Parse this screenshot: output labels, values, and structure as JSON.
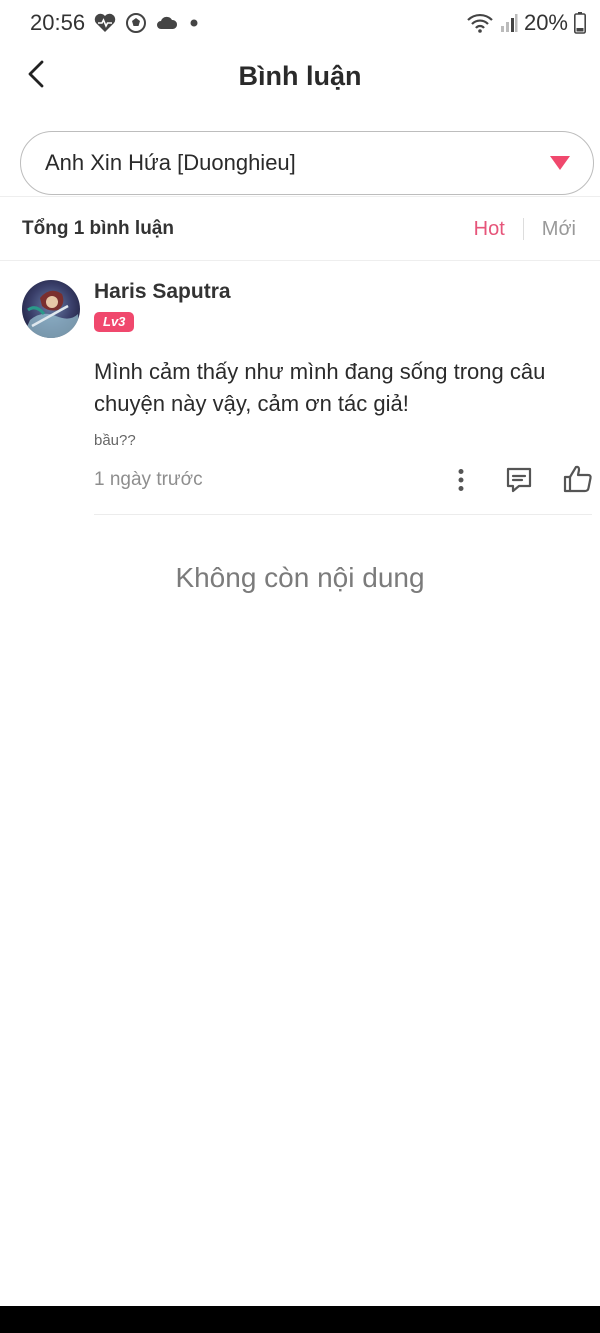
{
  "status_bar": {
    "time": "20:56",
    "battery": "20%",
    "icons": [
      "heart-rate-icon",
      "soccer-ball-icon",
      "cloud-icon",
      "dot-icon",
      "wifi-icon",
      "signal-icon",
      "battery-icon"
    ]
  },
  "header": {
    "title": "Bình luận",
    "back_icon": "back-arrow-icon"
  },
  "chapter_selector": {
    "selected": "Anh Xin Hứa [Duonghieu]",
    "icon": "dropdown-triangle-icon",
    "accent": "#f0486d"
  },
  "comments_summary": {
    "count_label": "Tổng 1 bình luận",
    "sort_tabs": [
      {
        "label": "Hot",
        "active": true
      },
      {
        "label": "Mới",
        "active": false
      }
    ]
  },
  "comments": [
    {
      "username": "Haris Saputra",
      "level": "Lv3",
      "text": "Mình cảm thấy như mình đang sống trong câu chuyện này vậy, cảm ơn tác giả!",
      "chapter_ref": "bầu??",
      "timestamp": "1 ngày trước",
      "actions": [
        "more-vertical-icon",
        "reply-comment-icon",
        "thumbs-up-icon"
      ]
    }
  ],
  "empty_state": "Không còn nội dung",
  "colors": {
    "accent": "#e6557a",
    "badge": "#f0486d",
    "muted": "#999999"
  }
}
